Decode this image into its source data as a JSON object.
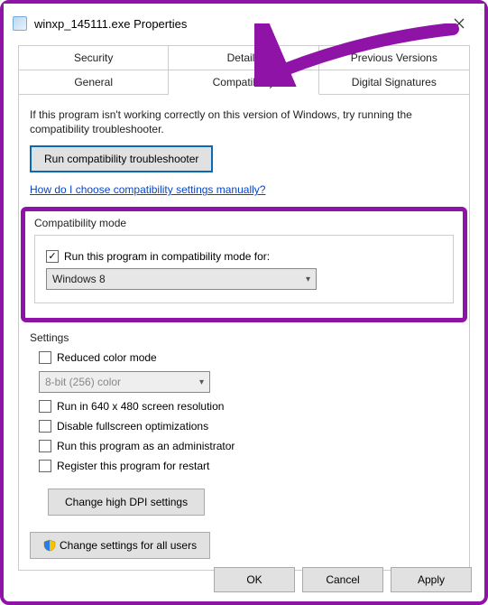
{
  "title": "winxp_145111.exe Properties",
  "tabs": {
    "row1": [
      "Security",
      "Details",
      "Previous Versions"
    ],
    "row2": [
      "General",
      "Compatibility",
      "Digital Signatures"
    ],
    "active": "Compatibility"
  },
  "intro": "If this program isn't working correctly on this version of Windows, try running the compatibility troubleshooter.",
  "troubleshoot_btn": "Run compatibility troubleshooter",
  "manual_link": "How do I choose compatibility settings manually?",
  "compat_mode": {
    "label": "Compatibility mode",
    "checkbox": "Run this program in compatibility mode for:",
    "checked": true,
    "selected": "Windows 8"
  },
  "settings": {
    "label": "Settings",
    "reduced_color": "Reduced color mode",
    "color_select": "8-bit (256) color",
    "res_640": "Run in 640 x 480 screen resolution",
    "disable_fullscreen": "Disable fullscreen optimizations",
    "run_admin": "Run this program as an administrator",
    "register_restart": "Register this program for restart",
    "dpi_btn": "Change high DPI settings"
  },
  "all_users_btn": "Change settings for all users",
  "footer": {
    "ok": "OK",
    "cancel": "Cancel",
    "apply": "Apply"
  }
}
